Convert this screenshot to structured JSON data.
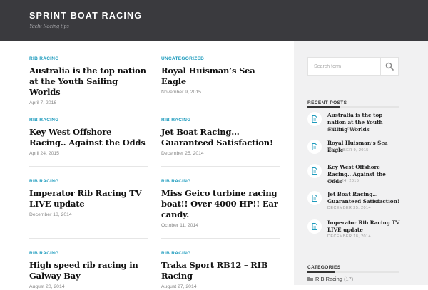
{
  "site": {
    "title": "SPRINT BOAT RACING",
    "description": "Yacht Racing tips"
  },
  "posts": [
    {
      "category": "RIB RACING",
      "title": "Australia is the top nation at the Youth Sailing Worlds",
      "date": "April 7, 2016"
    },
    {
      "category": "UNCATEGORIZED",
      "title": "Royal Huisman’s Sea Eagle",
      "date": "November 9, 2015"
    },
    {
      "category": "RIB RACING",
      "title": "Key West Offshore Racing.. Against the Odds",
      "date": "April 24, 2015"
    },
    {
      "category": "RIB RACING",
      "title": "Jet Boat Racing… Guaranteed Satisfaction!",
      "date": "December 25, 2014"
    },
    {
      "category": "RIB RACING",
      "title": "Imperator Rib Racing TV LIVE update",
      "date": "December 18, 2014"
    },
    {
      "category": "RIB RACING",
      "title": "Miss Geico turbine racing boat!! Over 4000 HP!! Ear candy.",
      "date": "October 11, 2014"
    },
    {
      "category": "RIB RACING",
      "title": "High speed rib racing in Galway Bay",
      "date": "August 20, 2014"
    },
    {
      "category": "RIB RACING",
      "title": "Traka Sport RB12 – RIB Racing",
      "date": "August 27, 2014"
    }
  ],
  "sidebar": {
    "search_placeholder": "Search form",
    "recent_posts_title": "RECENT POSTS",
    "recent_posts": [
      {
        "title": "Australia is the top nation at the Youth Sailing Worlds",
        "date": "APRIL 7, 2016"
      },
      {
        "title": "Royal Huisman’s Sea Eagle",
        "date": "NOVEMBER 9, 2015"
      },
      {
        "title": "Key West Offshore Racing.. Against the Odds",
        "date": "APRIL 24, 2015"
      },
      {
        "title": "Jet Boat Racing… Guaranteed Satisfaction!",
        "date": "DECEMBER 25, 2014"
      },
      {
        "title": "Imperator Rib Racing TV LIVE update",
        "date": "DECEMBER 18, 2014"
      }
    ],
    "categories_title": "CATEGORIES",
    "categories": [
      {
        "name": "RIB Racing",
        "count": "(17)"
      }
    ]
  },
  "colors": {
    "header_bg": "#3a3a3e",
    "accent": "#1d9bbd",
    "sidebar_bg": "#f1f1f2"
  },
  "icons": {
    "search": "search-icon",
    "post": "document-icon",
    "folder": "folder-icon"
  }
}
